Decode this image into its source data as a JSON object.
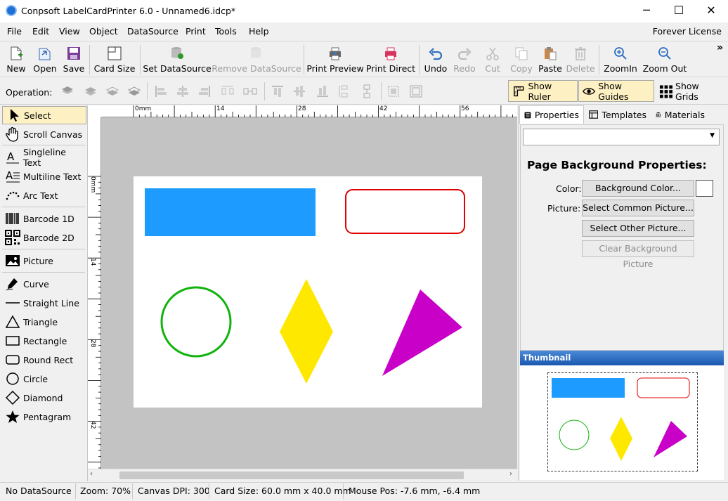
{
  "window": {
    "title": "Conpsoft LabelCardPrinter 6.0 - Unnamed6.idcp*",
    "minimize": "─",
    "maximize": "☐",
    "close": "✕"
  },
  "menu": {
    "items": [
      "File",
      "Edit",
      "View",
      "Object",
      "DataSource",
      "Print",
      "Tools",
      "Help"
    ],
    "license": "Forever License"
  },
  "toolbar": {
    "new": "New",
    "open": "Open",
    "save": "Save",
    "card_size": "Card Size",
    "set_datasource": "Set DataSource",
    "remove_datasource": "Remove DataSource",
    "print_preview": "Print Preview",
    "print_direct": "Print Direct",
    "undo": "Undo",
    "redo": "Redo",
    "cut": "Cut",
    "copy": "Copy",
    "paste": "Paste",
    "delete": "Delete",
    "zoom_in": "ZoomIn",
    "zoom_out": "Zoom Out",
    "overflow": "»"
  },
  "operation": {
    "label": "Operation:",
    "show_ruler": "Show Ruler",
    "show_guides": "Show Guides",
    "show_grids": "Show Grids"
  },
  "tools": [
    "Select",
    "Scroll Canvas",
    "Singleline Text",
    "Multiline Text",
    "Arc Text",
    "Barcode 1D",
    "Barcode 2D",
    "Picture",
    "Curve",
    "Straight Line",
    "Triangle",
    "Rectangle",
    "Round Rect",
    "Circle",
    "Diamond",
    "Pentagram"
  ],
  "ruler": {
    "h_labels": [
      "0mm",
      "14",
      "28",
      "42",
      "56"
    ],
    "v_labels": [
      "0mm",
      "14",
      "28",
      "42"
    ]
  },
  "shapes": {
    "rect_color": "#1e9bff",
    "roundrect_color": "#e00000",
    "circle_color": "#12b30d",
    "diamond_color": "#ffe800",
    "triangle_color": "#c800c8"
  },
  "right_panel": {
    "tabs": [
      "Properties",
      "Templates",
      "Materials"
    ],
    "combo_value": "",
    "title": "Page Background Properties:",
    "color_label": "Color:",
    "picture_label": "Picture:",
    "background_color_btn": "Background Color...",
    "select_common_btn": "Select Common Picture...",
    "select_other_btn": "Select Other Picture...",
    "clear_btn": "Clear Background Picture",
    "thumbnail_title": "Thumbnail"
  },
  "status": {
    "datasource": "No DataSource",
    "zoom": "Zoom: 70%",
    "dpi": "Canvas DPI: 300",
    "card_size": "Card Size: 60.0 mm x 40.0 mm",
    "mouse_pos": "Mouse Pos: -7.6 mm, -6.4 mm"
  }
}
